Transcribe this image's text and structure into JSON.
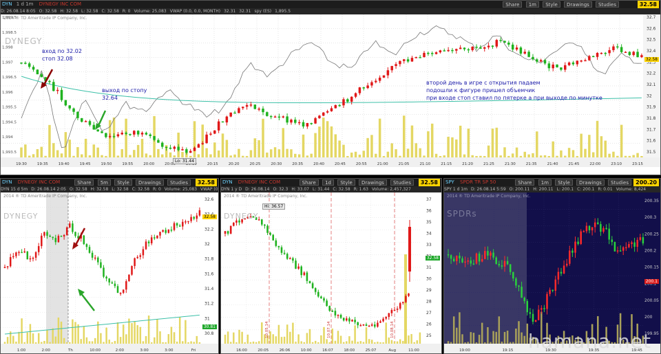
{
  "main": {
    "symbol": "DYN",
    "agg": "1 d 1m",
    "company": "DYNEGY INC COM",
    "share": "Share",
    "interval": "1m",
    "style": "Style",
    "drawings": "Drawings",
    "studies": "Studies",
    "price": "32.58",
    "info": [
      "D: 26.08.14 8:05",
      "O: 32.58",
      "H: 32.58",
      "L: 32.58",
      "C: 32.58",
      "R: 0",
      "Volume: 25,083",
      "VWAP (0.0, 0.0, MONTH)",
      "32.31",
      "32.31",
      "spy (ES)",
      "1,895.5"
    ],
    "copyright": "2014 ® TD Ameritrade IP Company, Inc.",
    "watermark": "DYNEGY",
    "note_entry": [
      "вход по 32.02",
      "стоп 32.08"
    ],
    "note_exit": [
      "выход по стопу",
      "32.64"
    ],
    "note_right": [
      "второй день в игре с открытия падаем",
      "подошли к фигуре пришел объемчик",
      "при входе стоп ставил по пятерке а при выходе по минутке"
    ],
    "low_tag": "Lo: 31.44",
    "last_tag": "32.58",
    "left_ticks": [
      "1,999.5",
      "1,998.5",
      "1,998",
      "1,997",
      "1,996.5",
      "1,996",
      "1,995.5",
      "1,994.5",
      "1,994",
      "1,993.5"
    ],
    "right_ticks": [
      "32.7",
      "32.6",
      "32.5",
      "32.4",
      "32.3",
      "32.2",
      "32.1",
      "32",
      "31.9",
      "31.8",
      "31.7",
      "31.6",
      "31.5"
    ],
    "time_ticks": [
      "19:30",
      "19:35",
      "19:40",
      "19:45",
      "19:50",
      "19:55",
      "20:00",
      "20:05",
      "20:10",
      "20:15",
      "20:20",
      "20:25",
      "20:30",
      "20:35",
      "20:40",
      "20:45",
      "20:55",
      "21:00",
      "21:05",
      "21:10",
      "21:15",
      "21:20",
      "21:25",
      "21:30",
      "21:35",
      "21:40",
      "21:45",
      "22:00",
      "23:10",
      "23:15"
    ]
  },
  "p1": {
    "symbol": "DYN",
    "company": "DYNEGY INC COM",
    "share": "Share",
    "interval": "5m",
    "style": "Style",
    "drawings": "Drawings",
    "studies": "Studies",
    "price": "32.58",
    "info": [
      "DYN 15 d 5m",
      "D: 26.08.14 2:05",
      "O: 32.58",
      "H: 32.58",
      "L: 32.58",
      "C: 32.58",
      "R: 0",
      "Volume: 25,083",
      "VWAP (0.0, 0.0, MONTH)"
    ],
    "copyright": "2014 ® TD Ameritrade IP Company, Inc.",
    "watermark": "DYNEGY",
    "ticks": [
      "32.6",
      "32.4",
      "32.2",
      "32",
      "31.8",
      "31.6",
      "31.4",
      "31.2",
      "31",
      "30.8"
    ],
    "time_ticks": [
      "1:00",
      "2:00",
      "Th",
      "10:00",
      "2:00",
      "3:00",
      "3:00",
      "Fri"
    ],
    "last_tag": "32.58",
    "green_tag": "30.81"
  },
  "p2": {
    "symbol": "DYN",
    "company": "DYNEGY INC COM",
    "share": "Share",
    "interval": "1d",
    "style": "Style",
    "drawings": "Drawings",
    "studies": "Studies",
    "price": "32.58",
    "info": [
      "DYN 1 y D",
      "D: 26.08.14",
      "O: 32.3",
      "H: 33.07",
      "L: 31.44",
      "C: 32.58",
      "R: 1.63",
      "Volume: 2,457,327"
    ],
    "copyright": "2014 ® TD Ameritrade IP Company, Inc.",
    "watermark": "DYNEGY",
    "hi_tag": "Hi: 36.57",
    "ticks": [
      "37",
      "36",
      "35",
      "34",
      "33",
      "32",
      "31",
      "30",
      "29",
      "28",
      "27",
      "26",
      "25"
    ],
    "time_ticks": [
      "16:00",
      "20:05",
      "26:06",
      "10:00",
      "16:07",
      "18:00",
      "25:07",
      "Aug",
      "11:00"
    ],
    "date_labels": [
      "10.05.14",
      "10.07.14",
      "10.08.14"
    ],
    "last_tag": "32.58"
  },
  "p3": {
    "symbol": "SPY",
    "company": "SPDR TR SP 50",
    "share": "Share",
    "interval": "1m",
    "style": "Style",
    "drawings": "Drawings",
    "studies": "Studies",
    "price": "200.20",
    "info": [
      "SPY 1 d 1m",
      "D: 26.08.14 5:59",
      "O: 200.11",
      "H: 200.11",
      "L: 200.1",
      "C: 200.1",
      "R: 0.01",
      "Volume: 8,424"
    ],
    "copyright": "2014 ® TD Ameritrade IP Company, Inc.",
    "watermark": "SPDRs",
    "ticks": [
      "200.35",
      "200.3",
      "200.25",
      "200.2",
      "200.15",
      "200.1",
      "200.05",
      "200",
      "199.95"
    ],
    "time_ticks": [
      "19:00",
      "19:15",
      "19:30",
      "19:35",
      "19:45"
    ],
    "last_tag": "200.1"
  },
  "site_watermark": "hamana.net"
}
